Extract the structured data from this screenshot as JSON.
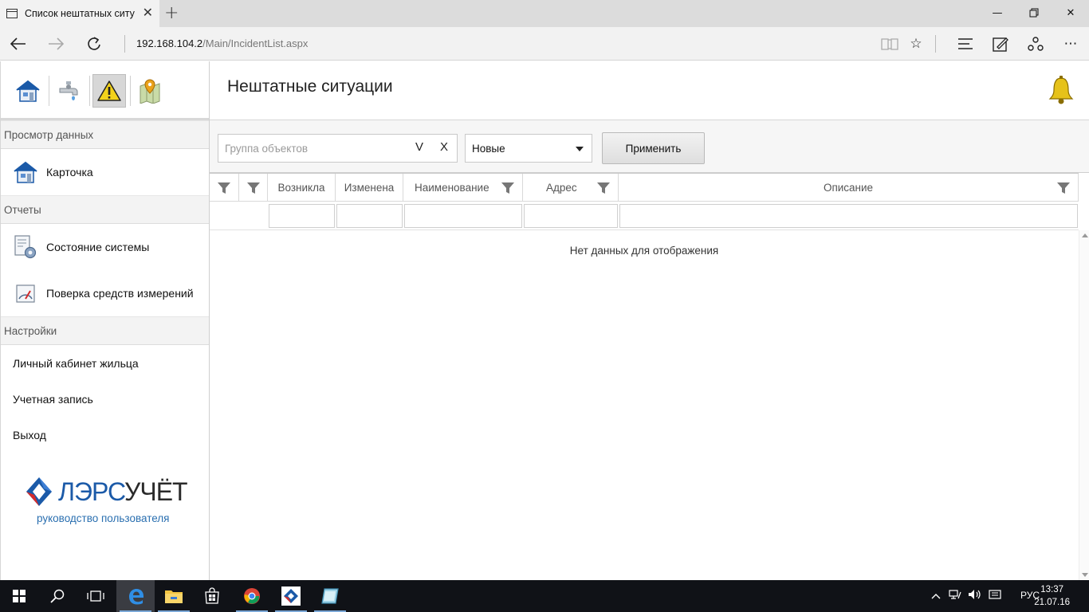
{
  "browser": {
    "tab_title": "Список нештатных ситу",
    "url_host": "192.168.104.2",
    "url_path": "/Main/IncidentList.aspx",
    "icons": {
      "tab": "page-icon",
      "close_tab": "close-icon",
      "new_tab": "plus-icon",
      "back": "arrow-left-icon",
      "forward": "arrow-right-icon",
      "refresh": "refresh-icon",
      "reading_view": "book-icon",
      "favorite": "star-icon",
      "hub": "hub-icon",
      "notes": "pen-icon",
      "share": "share-icon",
      "more": "more-icon"
    }
  },
  "sidebar": {
    "toolbar_icons": [
      "house-icon",
      "faucet-icon",
      "warning-icon",
      "map-pin-icon"
    ],
    "sections": {
      "data_view": "Просмотр данных",
      "reports": "Отчеты",
      "settings": "Настройки"
    },
    "items": {
      "card": "Карточка",
      "system_state": "Состояние системы",
      "verification": "Поверка средств измерений",
      "resident_cabinet": "Личный кабинет жильца",
      "account": "Учетная запись",
      "exit": "Выход"
    },
    "logo_text_1": "ЛЭРС",
    "logo_text_2": "УЧЁТ",
    "manual_link": "руководство пользователя"
  },
  "main": {
    "title": "Нештатные ситуации",
    "bell_icon": "bell-icon",
    "filter": {
      "group_placeholder": "Группа объектов",
      "group_select_btn": "V",
      "group_clear_btn": "X",
      "status_value": "Новые",
      "apply_label": "Применить"
    },
    "grid": {
      "columns": [
        "Возникла",
        "Изменена",
        "Наименование",
        "Адрес",
        "Описание"
      ],
      "empty_text": "Нет данных для отображения"
    }
  },
  "taskbar": {
    "lang": "РУС",
    "time": "13:37",
    "date": "21.07.16"
  },
  "colors": {
    "accent_blue": "#1b5aa8",
    "link_blue": "#2a6fb0",
    "warning_yellow": "#f2d21b",
    "taskbar": "#101217"
  }
}
